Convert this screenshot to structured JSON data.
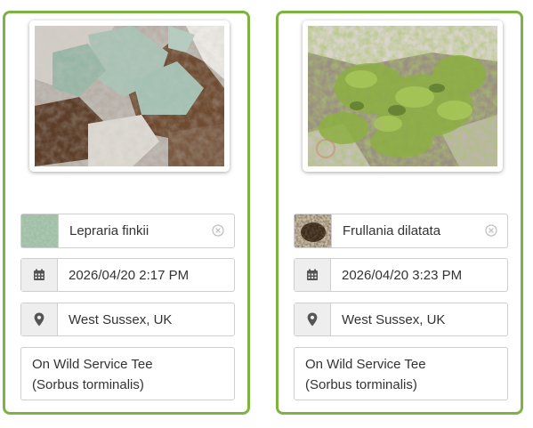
{
  "colors": {
    "card_border": "#7cb342",
    "input_border": "#cfcfcf",
    "addon_bg": "#eeeeee",
    "icon": "#555555"
  },
  "icons": {
    "date": "calendar-icon",
    "location": "map-marker-icon",
    "clear": "clear-circle-icon"
  },
  "cards": [
    {
      "photo": "lichen-on-bark-photo",
      "species": "Lepraria finkii",
      "datetime": "2026/04/20 2:17 PM",
      "location": "West Sussex, UK",
      "notes": "On Wild Service Tee\n(Sorbus torminalis)"
    },
    {
      "photo": "liverwort-on-bark-photo",
      "species": "Frullania dilatata",
      "datetime": "2026/04/20 3:23 PM",
      "location": "West Sussex, UK",
      "notes": "On Wild Service Tee\n(Sorbus torminalis)"
    }
  ]
}
